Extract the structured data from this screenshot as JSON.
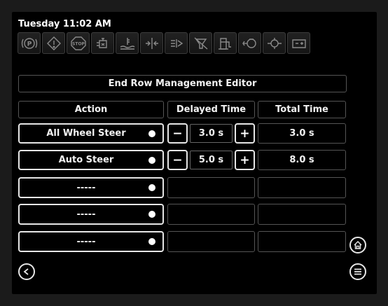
{
  "status": {
    "datetime": "Tuesday 11:02 AM"
  },
  "indicators": [
    {
      "name": "parking-brake-icon",
      "text": "(P)"
    },
    {
      "name": "warning-icon",
      "text": "!"
    },
    {
      "name": "stop-icon",
      "text": "STOP"
    },
    {
      "name": "engine-icon",
      "text": ""
    },
    {
      "name": "coolant-temperature-icon",
      "text": ""
    },
    {
      "name": "hydraulic-icon",
      "text": ""
    },
    {
      "name": "transmission-icon",
      "text": ""
    },
    {
      "name": "filter-restriction-icon",
      "text": ""
    },
    {
      "name": "fuel-icon",
      "text": ""
    },
    {
      "name": "oil-pressure-icon",
      "text": ""
    },
    {
      "name": "axle-icon",
      "text": ""
    },
    {
      "name": "battery-icon",
      "text": ""
    }
  ],
  "editor": {
    "title": "End Row Management Editor",
    "headers": {
      "action": "Action",
      "delayed": "Delayed Time",
      "total": "Total Time"
    },
    "rows": [
      {
        "action": "All Wheel Steer",
        "delayed": "3.0 s",
        "total": "3.0 s",
        "minus": "−",
        "plus": "+"
      },
      {
        "action": "Auto Steer",
        "delayed": "5.0 s",
        "total": "8.0 s",
        "minus": "−",
        "plus": "+"
      },
      {
        "action": "-----"
      },
      {
        "action": "-----"
      },
      {
        "action": "-----"
      }
    ]
  },
  "nav": {
    "back_icon": "chevron-left-icon",
    "home_icon": "home-icon",
    "menu_icon": "menu-icon"
  }
}
